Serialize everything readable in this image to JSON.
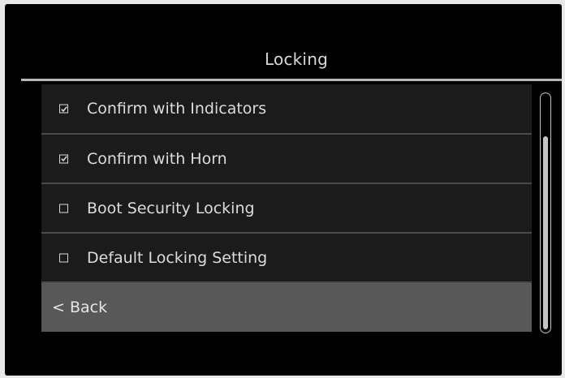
{
  "header": {
    "title": "Locking"
  },
  "menu": {
    "items": [
      {
        "label": "Confirm with Indicators",
        "checked": true
      },
      {
        "label": "Confirm with Horn",
        "checked": true
      },
      {
        "label": "Boot Security Locking",
        "checked": false
      },
      {
        "label": "Default Locking Setting",
        "checked": false
      }
    ],
    "back_label": "< Back"
  },
  "scroll": {
    "position_fraction": 0.18,
    "visible_fraction": 0.8
  },
  "colors": {
    "background": "#000000",
    "row_background": "#1b1b1b",
    "highlight_row": "#585858",
    "text": "#dcdcdc"
  }
}
